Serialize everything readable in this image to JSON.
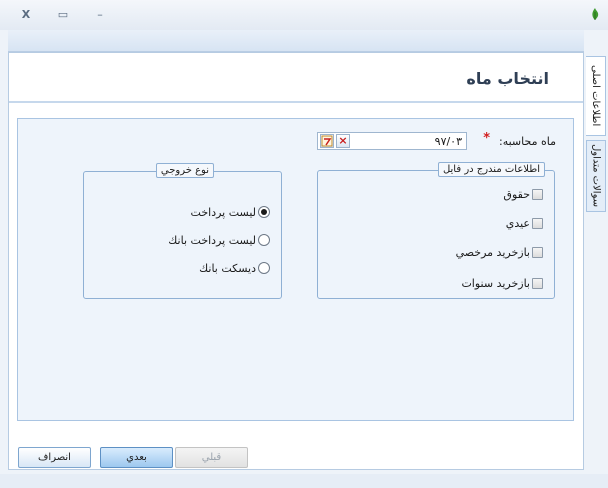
{
  "window": {
    "close_glyph": "X",
    "maximize_glyph": "▭",
    "minimize_glyph": "–",
    "icon": "leaf-icon"
  },
  "side_tabs": [
    {
      "label": "اطلاعات اصلی"
    },
    {
      "label": "سوالات متداول"
    }
  ],
  "page": {
    "title": "انتخاب ماه"
  },
  "form": {
    "month_label": "ماه محاسبه:",
    "required_mark": "*",
    "month_value": "۹۷/۰۳",
    "clear_glyph": "×",
    "calendar_icon": "calendar-icon"
  },
  "files_group": {
    "title": "اطلاعات مندرج در فایل",
    "options": [
      {
        "label": "حقوق",
        "checked": false
      },
      {
        "label": "عیدي",
        "checked": false
      },
      {
        "label": "بازخريد مرخصي",
        "checked": false
      },
      {
        "label": "بازخريد سنوات",
        "checked": false
      }
    ]
  },
  "output_group": {
    "title": "نوع خروجي",
    "options": [
      {
        "label": "ليست پرداخت",
        "selected": true
      },
      {
        "label": "ليست پرداخت بانك",
        "selected": false
      },
      {
        "label": "ديسكت بانك",
        "selected": false
      }
    ]
  },
  "buttons": {
    "prev": "قبلي",
    "next": "بعدي",
    "cancel": "انصراف"
  },
  "colors": {
    "accent": "#9dc8ef",
    "border": "#8fb0d4",
    "required": "#d21f1f"
  }
}
